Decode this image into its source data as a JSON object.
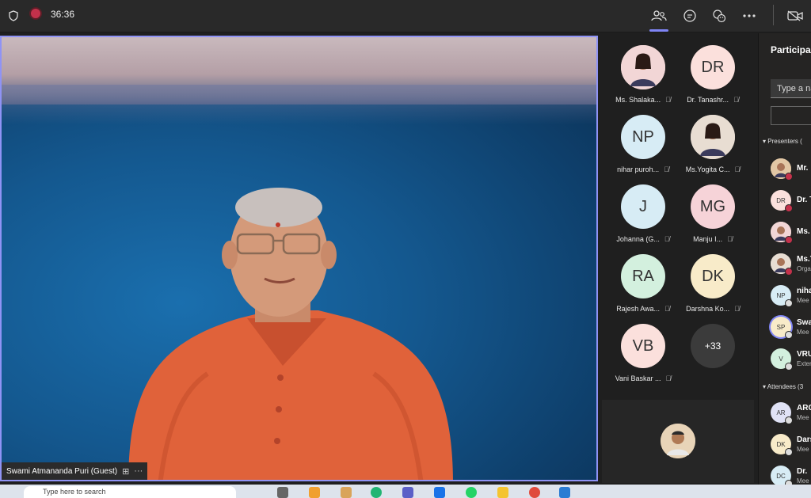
{
  "meeting": {
    "timer": "36:36"
  },
  "toolbar": {
    "icons": [
      "shield-icon",
      "record-icon",
      "people-icon",
      "chat-icon",
      "reactions-icon",
      "more-icon",
      "camera-icon"
    ]
  },
  "stage": {
    "speaker_name": "Swami Atmananda Puri (Guest)",
    "more_label": "···"
  },
  "gallery": {
    "tiles": [
      {
        "label": "Ms. Shalaka...",
        "initials": "",
        "color": "#f2d6d6",
        "photo": true
      },
      {
        "label": "Dr. Tanashr...",
        "initials": "DR",
        "color": "#fbe0dc"
      },
      {
        "label": "nihar puroh...",
        "initials": "NP",
        "color": "#d7ecf5"
      },
      {
        "label": "Ms.Yogita C...",
        "initials": "",
        "color": "#e8ddd2",
        "photo": true
      },
      {
        "label": "Johanna (G...",
        "initials": "J",
        "color": "#d7ecf5"
      },
      {
        "label": "Manju I...",
        "initials": "MG",
        "color": "#f6d3d8"
      },
      {
        "label": "Rajesh Awa...",
        "initials": "RA",
        "color": "#d3f0de"
      },
      {
        "label": "Darshna Ko...",
        "initials": "DK",
        "color": "#f8ebc9"
      },
      {
        "label": "Vani Baskar ...",
        "initials": "VB",
        "color": "#fbe0dc"
      }
    ],
    "more_count": "+33"
  },
  "participants": {
    "title": "Participa",
    "search_placeholder": "Type a na",
    "presenters_label": "Presenters (",
    "attendees_label": "Attendees (3",
    "presenters": [
      {
        "initials": "",
        "name": "Mr.",
        "role": "",
        "color": "#e2c7a5",
        "status": "#c4314b"
      },
      {
        "initials": "DR",
        "name": "Dr. T",
        "role": "",
        "color": "#fbe0dc",
        "status": "#c4314b"
      },
      {
        "initials": "",
        "name": "Ms.",
        "role": "",
        "color": "#f2d6d6",
        "status": "#c4314b"
      },
      {
        "initials": "",
        "name": "Ms.Y",
        "role": "Orga",
        "color": "#e8ddd2",
        "status": "#c4314b"
      },
      {
        "initials": "NP",
        "name": "niha",
        "role": "Mee",
        "color": "#d7ecf5",
        "status": "#ddd"
      },
      {
        "initials": "SP",
        "name": "Swa",
        "role": "Mee",
        "color": "#f8ebc9",
        "status": "#ddd"
      },
      {
        "initials": "V",
        "name": "VRU",
        "role": "Exter",
        "color": "#d3f0de",
        "status": "#ddd"
      }
    ],
    "attendees": [
      {
        "initials": "AR",
        "name": "ARC",
        "role": "Mee",
        "color": "#e0e2f5",
        "status": "#ddd"
      },
      {
        "initials": "DK",
        "name": "Dars",
        "role": "Mee",
        "color": "#f8ebc9",
        "status": "#ddd"
      },
      {
        "initials": "DC",
        "name": "Dr.",
        "role": "Mee",
        "color": "#d7ecf5",
        "status": "#ddd"
      }
    ]
  },
  "taskbar": {
    "search_placeholder": "Type here to search"
  }
}
